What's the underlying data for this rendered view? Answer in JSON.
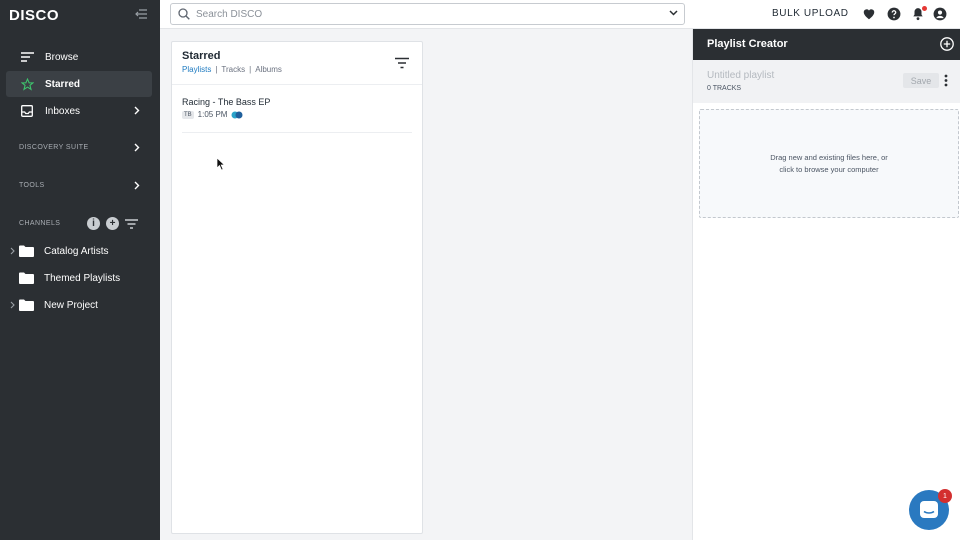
{
  "app": {
    "logo": "DISCO"
  },
  "sidebar": {
    "items": [
      {
        "label": "Browse",
        "icon": "browse-icon"
      },
      {
        "label": "Starred",
        "icon": "star-icon",
        "active": true
      },
      {
        "label": "Inboxes",
        "icon": "inbox-icon"
      }
    ],
    "sections": {
      "discovery": "DISCOVERY SUITE",
      "tools": "TOOLS",
      "channels": "CHANNELS"
    },
    "channels": [
      {
        "label": "Catalog Artists",
        "expandable": true
      },
      {
        "label": "Themed Playlists",
        "expandable": false
      },
      {
        "label": "New Project",
        "expandable": true
      }
    ]
  },
  "topbar": {
    "search_placeholder": "Search DISCO",
    "bulk_upload": "BULK UPLOAD"
  },
  "starred": {
    "title": "Starred",
    "tabs": [
      "Playlists",
      "Tracks",
      "Albums"
    ],
    "active_tab": "Playlists",
    "tracks": [
      {
        "title": "Racing - The Bass EP",
        "badge": "TB",
        "time": "1:05 PM"
      }
    ]
  },
  "playlist_creator": {
    "title": "Playlist Creator",
    "playlist_name": "Untitled playlist",
    "track_count": "0 TRACKS",
    "save_label": "Save",
    "drop_line1": "Drag new and existing files here, or",
    "drop_line2": "click to browse your computer"
  },
  "chat": {
    "unread": "1"
  },
  "colors": {
    "sidebar": "#2b2f33",
    "accent": "#1f7bc1",
    "star": "#3ec46d",
    "chat": "#2a79c0"
  }
}
